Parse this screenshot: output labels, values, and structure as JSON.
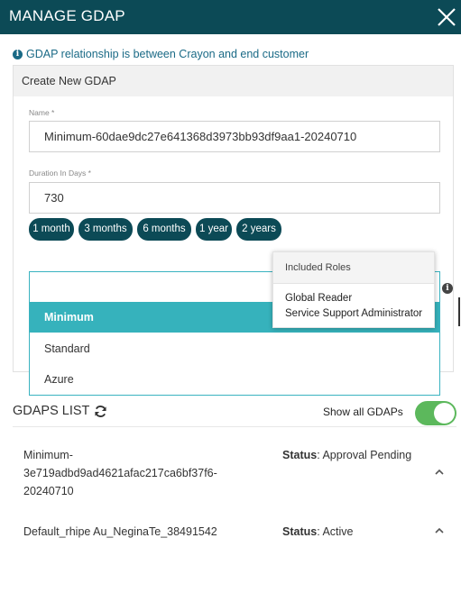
{
  "header": {
    "title": "MANAGE GDAP"
  },
  "info_text": "GDAP relationship is between Crayon and end customer",
  "create": {
    "heading": "Create New GDAP",
    "name_label": "Name *",
    "name_value": "Minimum-60dae9dc27e641368d3973bb93df9aa1-20240710",
    "duration_label": "Duration In Days *",
    "duration_value": "730",
    "chips": [
      "1 month",
      "3 months",
      "6 months",
      "1 year",
      "2 years"
    ]
  },
  "role_dropdown": {
    "search_value": "",
    "options": [
      {
        "label": "Minimum",
        "selected": true
      },
      {
        "label": "Standard",
        "selected": false
      },
      {
        "label": "Azure",
        "selected": false
      }
    ]
  },
  "tooltip": {
    "heading": "Included Roles",
    "roles": [
      "Global Reader",
      "Service Support Administrator"
    ]
  },
  "list": {
    "title": "GDAPS LIST",
    "show_all_label": "Show all GDAPs",
    "show_all_on": true,
    "status_label": "Status",
    "items": [
      {
        "name_lines": [
          "Minimum-",
          "3e719adbd9ad4621afac217ca6bf37f6-",
          "20240710"
        ],
        "status": "Approval Pending"
      },
      {
        "name_lines": [
          "Default_rhipe Au_NeginaTe_38491542"
        ],
        "status": "Active"
      }
    ]
  },
  "colors": {
    "header": "#0c4a56",
    "accent": "#36b2bc",
    "info": "#1a6a86",
    "toggle_on": "#5cb85c"
  }
}
